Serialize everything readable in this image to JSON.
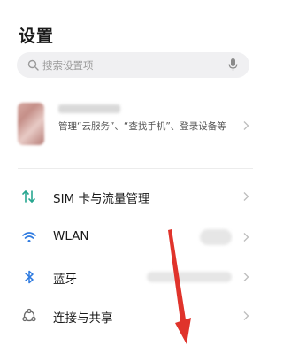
{
  "header": {
    "title": "设置"
  },
  "search": {
    "placeholder": "搜索设置项"
  },
  "account": {
    "description": "管理“云服务”、“查找手机”、登录设备等"
  },
  "settings": {
    "items": [
      {
        "label": "SIM 卡与流量管理",
        "icon": "sim-data-icon",
        "color": "#27a68f"
      },
      {
        "label": "WLAN",
        "icon": "wifi-icon",
        "color": "#2f7be0"
      },
      {
        "label": "蓝牙",
        "icon": "bluetooth-icon",
        "color": "#2f7be0"
      },
      {
        "label": "连接与共享",
        "icon": "connection-sharing-icon",
        "color": "#6a6a6a"
      }
    ]
  },
  "colors": {
    "annotation_arrow": "#e0332b",
    "search_bg": "#f0f0f2"
  }
}
